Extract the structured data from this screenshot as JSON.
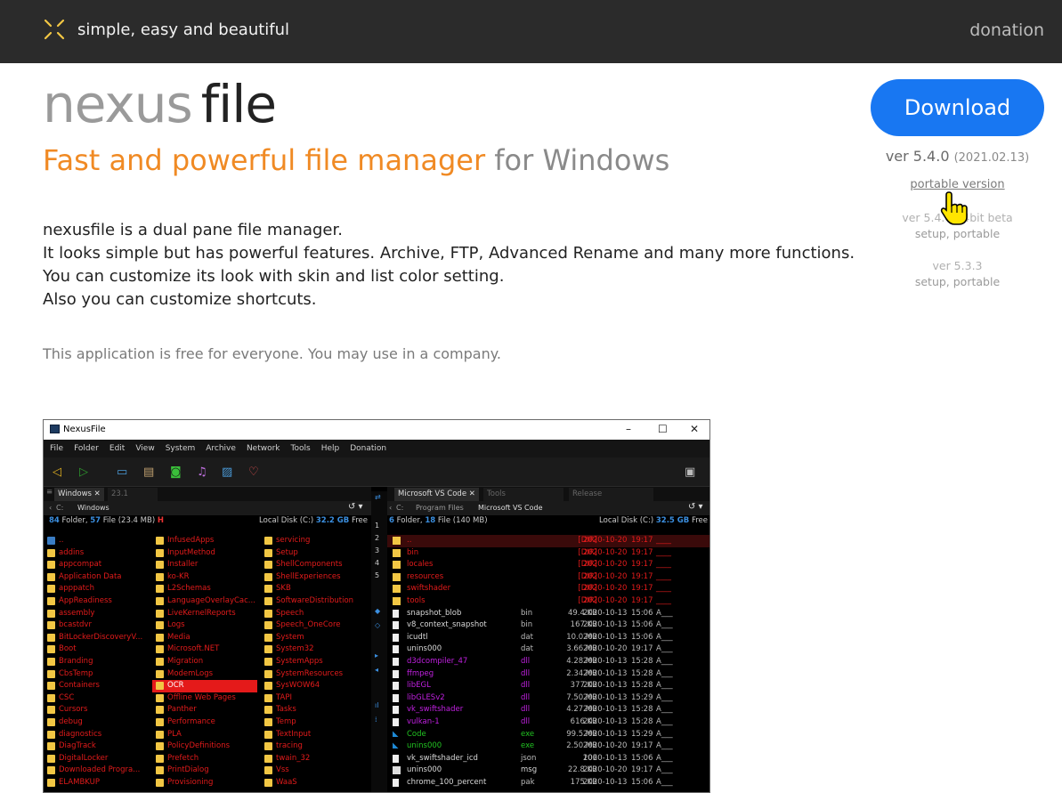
{
  "header": {
    "tagline": "simple, easy and beautiful",
    "donation": "donation"
  },
  "hero": {
    "title_part1": "nexus",
    "title_part2": "file",
    "subtitle_orange": "Fast and powerful file manager",
    "subtitle_grey": "for Windows",
    "description": [
      "nexusfile is a dual pane file manager.",
      "It looks simple but has powerful features. Archive, FTP, Advanced Rename and many more functions.",
      "You can customize its look with skin and list color setting.",
      "Also you can customize shortcuts."
    ],
    "free_note": "This application is free for everyone. You may use in a company."
  },
  "download": {
    "button": "Download",
    "version": "ver 5.4.0",
    "date": "(2021.02.13)",
    "portable": "portable version",
    "beta_version": "ver 5.4.0 64bit beta",
    "beta_links": "setup, portable",
    "old_version": "ver 5.3.3",
    "old_links": "setup, portable"
  },
  "colors": {
    "topbar": "#2b2b2b",
    "accent_orange": "#f08a24",
    "download_blue": "#1877f2",
    "logo_yellow": "#f2c744"
  },
  "app": {
    "title": "NexusFile",
    "menu": [
      "File",
      "Folder",
      "Edit",
      "View",
      "System",
      "Archive",
      "Network",
      "Tools",
      "Help",
      "Donation"
    ],
    "toolbar_icons": [
      "back-icon",
      "forward-icon",
      "window-icon",
      "folder-icon",
      "camera-icon",
      "music-icon",
      "box-icon",
      "heart-icon",
      "trash-icon"
    ],
    "left": {
      "tab_active": "Windows",
      "tab_other": "23.1",
      "path": [
        "C:",
        "Windows"
      ],
      "info_folders": "84",
      "info_folders_label": "Folder,",
      "info_files": "57",
      "info_files_label": "File",
      "info_size": "(23.4 MB)",
      "info_flag": "H",
      "disk_label": "Local Disk (C:)",
      "disk_free": "32.2 GB",
      "disk_free_label": "Free",
      "col1": [
        "..",
        "addins",
        "appcompat",
        "Application Data",
        "apppatch",
        "AppReadiness",
        "assembly",
        "bcastdvr",
        "BitLockerDiscoveryV...",
        "Boot",
        "Branding",
        "CbsTemp",
        "Containers",
        "CSC",
        "Cursors",
        "debug",
        "diagnostics",
        "DiagTrack",
        "DigitalLocker",
        "Downloaded Progra...",
        "ELAMBKUP"
      ],
      "col2": [
        "InfusedApps",
        "InputMethod",
        "Installer",
        "ko-KR",
        "L2Schemas",
        "LanguageOverlayCac...",
        "LiveKernelReports",
        "Logs",
        "Media",
        "Microsoft.NET",
        "Migration",
        "ModemLogs",
        "OCR",
        "Offline Web Pages",
        "Panther",
        "Performance",
        "PLA",
        "PolicyDefinitions",
        "Prefetch",
        "PrintDialog",
        "Provisioning"
      ],
      "col3": [
        "servicing",
        "Setup",
        "ShellComponents",
        "ShellExperiences",
        "SKB",
        "SoftwareDistribution",
        "Speech",
        "Speech_OneCore",
        "System",
        "System32",
        "SystemApps",
        "SystemResources",
        "SysWOW64",
        "TAPI",
        "Tasks",
        "Temp",
        "TextInput",
        "tracing",
        "twain_32",
        "Vss",
        "WaaS"
      ]
    },
    "right": {
      "tab_active": "Microsoft VS Code",
      "tab_tools": "Tools",
      "tab_release": "Release",
      "path": [
        "C:",
        "Program Files",
        "Microsoft VS Code"
      ],
      "info_folders": "6",
      "info_folders_label": "Folder,",
      "info_files": "18",
      "info_files_label": "File",
      "info_size": "(140 MB)",
      "disk_label": "Local Disk (C:)",
      "disk_free": "32.5 GB",
      "disk_free_label": "Free",
      "files": [
        {
          "name": "..",
          "ext": "",
          "size": "[DIR]",
          "date": "2020-10-20",
          "time": "19:17",
          "attr": "____",
          "color": "#e21b1b",
          "icon": "folder"
        },
        {
          "name": "bin",
          "ext": "",
          "size": "[DIR]",
          "date": "2020-10-20",
          "time": "19:17",
          "attr": "____",
          "color": "#e21b1b",
          "icon": "folder"
        },
        {
          "name": "locales",
          "ext": "",
          "size": "[DIR]",
          "date": "2020-10-20",
          "time": "19:17",
          "attr": "____",
          "color": "#e21b1b",
          "icon": "folder"
        },
        {
          "name": "resources",
          "ext": "",
          "size": "[DIR]",
          "date": "2020-10-20",
          "time": "19:17",
          "attr": "____",
          "color": "#e21b1b",
          "icon": "folder"
        },
        {
          "name": "swiftshader",
          "ext": "",
          "size": "[DIR]",
          "date": "2020-10-20",
          "time": "19:17",
          "attr": "____",
          "color": "#e21b1b",
          "icon": "folder"
        },
        {
          "name": "tools",
          "ext": "",
          "size": "[DIR]",
          "date": "2020-10-20",
          "time": "19:17",
          "attr": "____",
          "color": "#e21b1b",
          "icon": "folder"
        },
        {
          "name": "snapshot_blob",
          "ext": "bin",
          "size": "49.4 KB",
          "date": "2020-10-13",
          "time": "15:06",
          "attr": "A___",
          "color": "#d8d8d8",
          "icon": "file"
        },
        {
          "name": "v8_context_snapshot",
          "ext": "bin",
          "size": "167 KB",
          "date": "2020-10-13",
          "time": "15:06",
          "attr": "A___",
          "color": "#d8d8d8",
          "icon": "file"
        },
        {
          "name": "icudtl",
          "ext": "dat",
          "size": "10.0 MB",
          "date": "2020-10-13",
          "time": "15:06",
          "attr": "A___",
          "color": "#d8d8d8",
          "icon": "file"
        },
        {
          "name": "unins000",
          "ext": "dat",
          "size": "3.66 MB",
          "date": "2020-10-20",
          "time": "19:17",
          "attr": "A___",
          "color": "#d8d8d8",
          "icon": "file"
        },
        {
          "name": "d3dcompiler_47",
          "ext": "dll",
          "size": "4.28 MB",
          "date": "2020-10-13",
          "time": "15:28",
          "attr": "A___",
          "color": "#c020e0",
          "icon": "file"
        },
        {
          "name": "ffmpeg",
          "ext": "dll",
          "size": "2.34 MB",
          "date": "2020-10-13",
          "time": "15:28",
          "attr": "A___",
          "color": "#c020e0",
          "icon": "file"
        },
        {
          "name": "libEGL",
          "ext": "dll",
          "size": "377 KB",
          "date": "2020-10-13",
          "time": "15:28",
          "attr": "A___",
          "color": "#c020e0",
          "icon": "file"
        },
        {
          "name": "libGLESv2",
          "ext": "dll",
          "size": "7.50 MB",
          "date": "2020-10-13",
          "time": "15:29",
          "attr": "A___",
          "color": "#c020e0",
          "icon": "file"
        },
        {
          "name": "vk_swiftshader",
          "ext": "dll",
          "size": "4.27 MB",
          "date": "2020-10-13",
          "time": "15:28",
          "attr": "A___",
          "color": "#c020e0",
          "icon": "file"
        },
        {
          "name": "vulkan-1",
          "ext": "dll",
          "size": "616 KB",
          "date": "2020-10-13",
          "time": "15:28",
          "attr": "A___",
          "color": "#c020e0",
          "icon": "file"
        },
        {
          "name": "Code",
          "ext": "exe",
          "size": "99.5 MB",
          "date": "2020-10-13",
          "time": "15:29",
          "attr": "A___",
          "color": "#22c322",
          "icon": "vscode"
        },
        {
          "name": "unins000",
          "ext": "exe",
          "size": "2.50 MB",
          "date": "2020-10-20",
          "time": "19:17",
          "attr": "A___",
          "color": "#22c322",
          "icon": "vscode"
        },
        {
          "name": "vk_swiftshader_icd",
          "ext": "json",
          "size": "106",
          "date": "2020-10-13",
          "time": "15:06",
          "attr": "A___",
          "color": "#d8d8d8",
          "icon": "file"
        },
        {
          "name": "unins000",
          "ext": "msg",
          "size": "22.8 KB",
          "date": "2020-10-20",
          "time": "19:17",
          "attr": "A___",
          "color": "#d8d8d8",
          "icon": "mail"
        },
        {
          "name": "chrome_100_percent",
          "ext": "pak",
          "size": "175 KB",
          "date": "2020-10-13",
          "time": "15:06",
          "attr": "A___",
          "color": "#d8d8d8",
          "icon": "file"
        }
      ]
    }
  }
}
